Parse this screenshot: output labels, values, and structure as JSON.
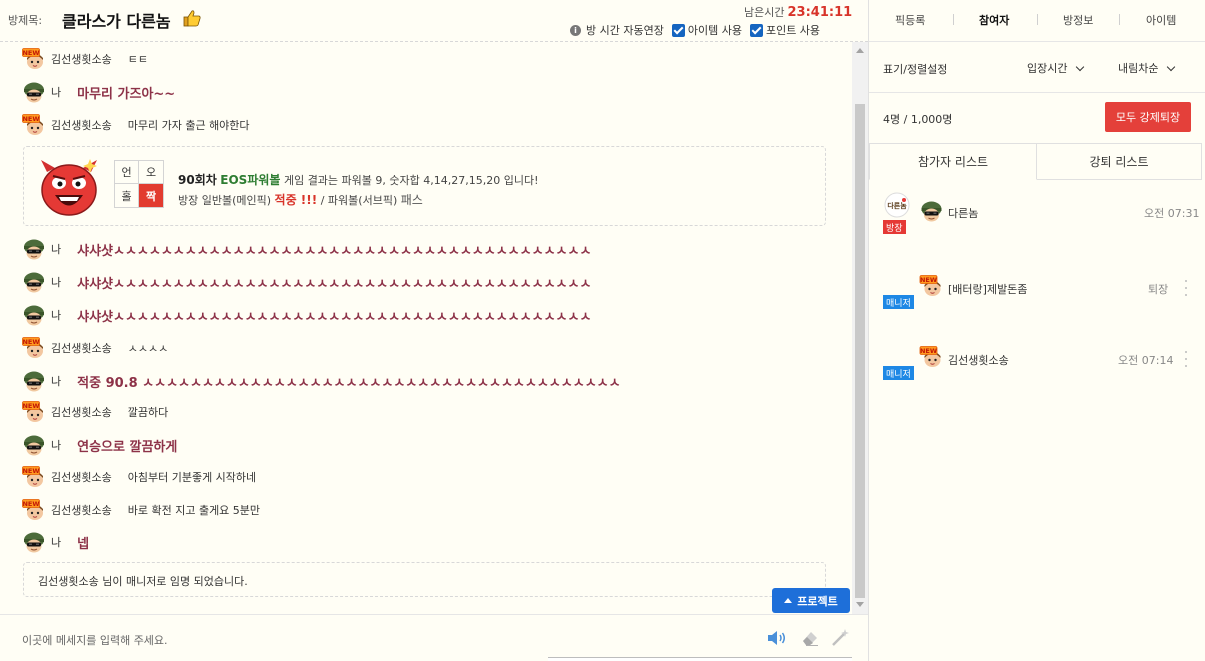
{
  "header": {
    "room_label": "방제목:",
    "room_title": "클라스가 다른놈",
    "time_label": "남은시간",
    "time_value": "23:41:11",
    "auto_extend_label": "방 시간 자동연장",
    "item_use_label": "아이템 사용",
    "point_use_label": "포인트 사용"
  },
  "chat": {
    "messages": [
      {
        "type": "other",
        "sender": "김선생횟소송",
        "text": "ㅌㅌ"
      },
      {
        "type": "me",
        "sender": "나",
        "text": "마무리 가즈아~~"
      },
      {
        "type": "other",
        "sender": "김선생횟소송",
        "text": "마무리 가자 출근 해야한다"
      },
      {
        "type": "me",
        "sender": "나",
        "text": "샤샤샷ㅅㅅㅅㅅㅅㅅㅅㅅㅅㅅㅅㅅㅅㅅㅅㅅㅅㅅㅅㅅㅅㅅㅅㅅㅅㅅㅅㅅㅅㅅㅅㅅㅅㅅㅅㅅㅅㅅㅅㅅ"
      },
      {
        "type": "me",
        "sender": "나",
        "text": "샤샤샷ㅅㅅㅅㅅㅅㅅㅅㅅㅅㅅㅅㅅㅅㅅㅅㅅㅅㅅㅅㅅㅅㅅㅅㅅㅅㅅㅅㅅㅅㅅㅅㅅㅅㅅㅅㅅㅅㅅㅅㅅ"
      },
      {
        "type": "me",
        "sender": "나",
        "text": "샤샤샷ㅅㅅㅅㅅㅅㅅㅅㅅㅅㅅㅅㅅㅅㅅㅅㅅㅅㅅㅅㅅㅅㅅㅅㅅㅅㅅㅅㅅㅅㅅㅅㅅㅅㅅㅅㅅㅅㅅㅅㅅ"
      },
      {
        "type": "other",
        "sender": "김선생횟소송",
        "text": "ㅅㅅㅅㅅ"
      },
      {
        "type": "me",
        "sender": "나",
        "text": "적중 90.8 ㅅㅅㅅㅅㅅㅅㅅㅅㅅㅅㅅㅅㅅㅅㅅㅅㅅㅅㅅㅅㅅㅅㅅㅅㅅㅅㅅㅅㅅㅅㅅㅅㅅㅅㅅㅅㅅㅅㅅㅅ"
      },
      {
        "type": "other",
        "sender": "김선생횟소송",
        "text": "깔끔하다"
      },
      {
        "type": "me",
        "sender": "나",
        "text": "연승으로 깔끔하게"
      },
      {
        "type": "other",
        "sender": "김선생횟소송",
        "text": "아침부터 기분좋게 시작하네"
      },
      {
        "type": "other",
        "sender": "김선생횟소송",
        "text": "바로 확전 지고 출게요 5분만"
      },
      {
        "type": "me",
        "sender": "나",
        "text": "넵"
      }
    ],
    "result": {
      "grid": [
        "언",
        "오",
        "홀",
        "짝"
      ],
      "round": "90회차",
      "game": "EOS파워볼",
      "result_text": "게임 결과는 파워볼 9, 숫자합 4,14,27,15,20 입니다!",
      "pick_text": "방장 일반볼(메인픽)",
      "hit": "적중 !!!",
      "sep": "/ 파워볼(서브픽)",
      "pass": "패스"
    },
    "system_message": "김선생횟소송 님이 매니저로 임명 되었습니다.",
    "project_button": "프로젝트",
    "input_placeholder": "이곳에 메세지를 입력해 주세요."
  },
  "sidebar": {
    "tabs": [
      "픽등록",
      "참여자",
      "방정보",
      "아이템"
    ],
    "active_tab": "참여자",
    "sort_label": "표기/정렬설정",
    "sort_by": "입장시간",
    "sort_order": "내림차순",
    "count": "4명 / 1,000명",
    "kick_all_button": "모두 강제퇴장",
    "list_tabs": [
      "참가자 리스트",
      "강퇴 리스트"
    ],
    "users": [
      {
        "badge": "방장",
        "name": "다른놈",
        "time": "오전 07:31",
        "logo": "다른놈"
      },
      {
        "badge": "매니저",
        "name": "[배터랑]제발돈좀",
        "time": "퇴장"
      },
      {
        "badge": "매니저",
        "name": "김선생횟소송",
        "time": "오전 07:14"
      }
    ]
  },
  "colors": {
    "accent_red": "#e4403a",
    "time_red": "#d8342a",
    "my_text": "#8d3248",
    "button_blue": "#1e6fd9",
    "background": "#fffef5"
  }
}
